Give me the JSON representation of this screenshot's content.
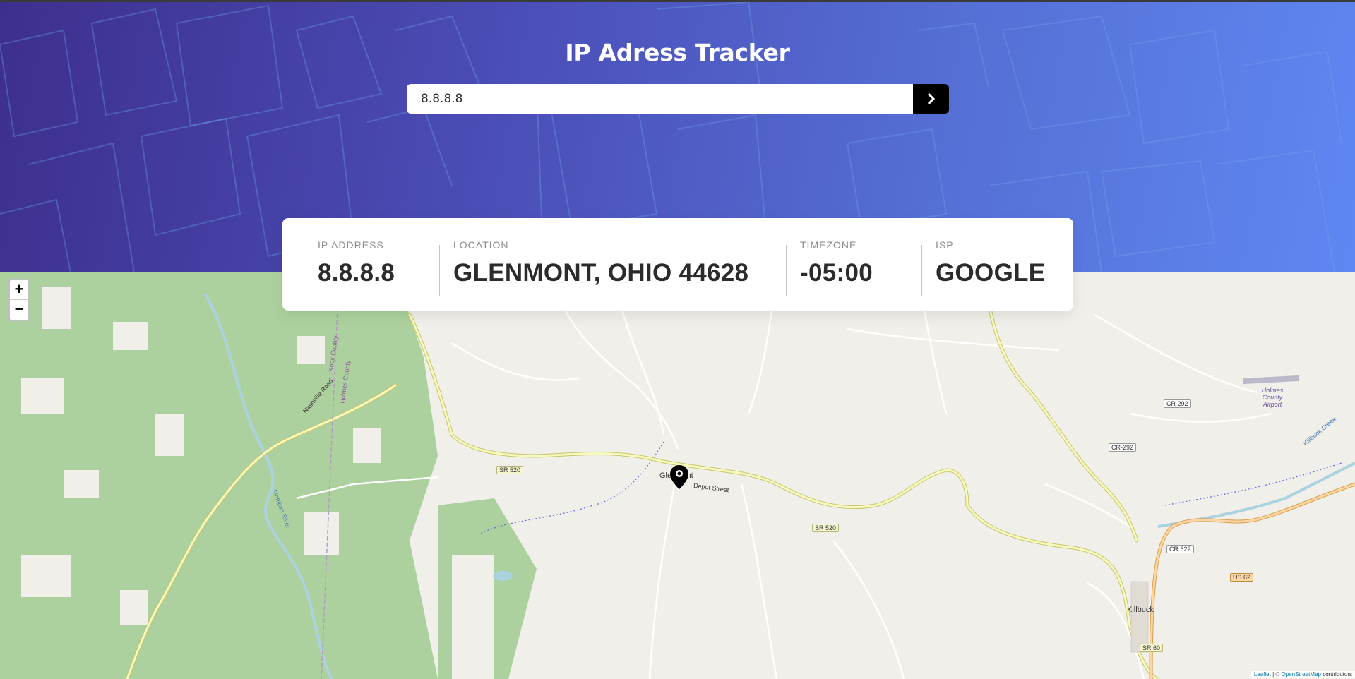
{
  "app": {
    "title": "IP Adress Tracker"
  },
  "search": {
    "value": "8.8.8.8",
    "submit_icon": "chevron-right-icon"
  },
  "info": {
    "ip_label": "IP ADDRESS",
    "ip_value": "8.8.8.8",
    "location_label": "LOCATION",
    "location_value": "GLENMONT, OHIO 44628",
    "timezone_label": "TIMEZONE",
    "timezone_value": "-05:00",
    "isp_label": "ISP",
    "isp_value": "GOOGLE"
  },
  "map": {
    "zoom_in": "+",
    "zoom_out": "−",
    "marker_icon": "location-pin-icon",
    "labels": {
      "town_center": "Glenmont",
      "town_east": "Killbuck",
      "depot_street": "Depot Street",
      "nashville_road": "Nashville Road",
      "knox_county": "Knox County",
      "holmes_county": "Holmes County",
      "airport": "Holmes County Airport",
      "mohican_river": "Mohican River",
      "killbuck_creek": "Killbuck Creek"
    },
    "shields": {
      "sr520_west": "SR 520",
      "sr520_east": "SR 520",
      "cr292": "CR 292",
      "cr292_dash": "CR-292",
      "cr622": "CR 622",
      "us62": "US 62",
      "sr60": "SR 60"
    },
    "attribution": {
      "leaflet": "Leaflet",
      "separator": " | © ",
      "osm": "OpenStreetMap",
      "suffix": " contributors"
    }
  },
  "colors": {
    "header_start": "#3d2f8e",
    "header_end": "#5f87f2",
    "button": "#000000",
    "forest": "#add19e",
    "road_yellow": "#f7fabf"
  }
}
